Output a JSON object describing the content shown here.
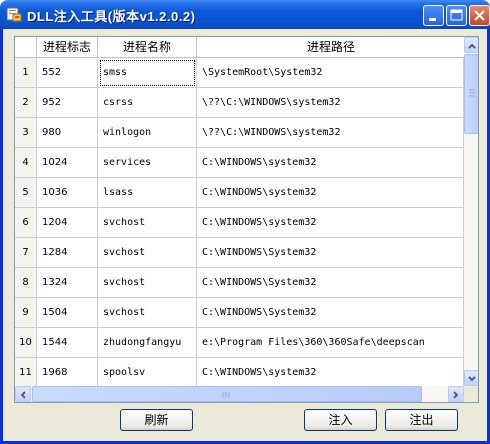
{
  "window": {
    "title": "DLL注入工具(版本v1.2.0.2)"
  },
  "grid": {
    "columns": {
      "pid": "进程标志",
      "name": "进程名称",
      "path": "进程路径"
    },
    "rows": [
      {
        "num": "1",
        "pid": "552",
        "name": "smss",
        "path": "\\SystemRoot\\System32"
      },
      {
        "num": "2",
        "pid": "952",
        "name": "csrss",
        "path": "\\??\\C:\\WINDOWS\\system32"
      },
      {
        "num": "3",
        "pid": "980",
        "name": "winlogon",
        "path": "\\??\\C:\\WINDOWS\\system32"
      },
      {
        "num": "4",
        "pid": "1024",
        "name": "services",
        "path": "C:\\WINDOWS\\system32"
      },
      {
        "num": "5",
        "pid": "1036",
        "name": "lsass",
        "path": "C:\\WINDOWS\\system32"
      },
      {
        "num": "6",
        "pid": "1204",
        "name": "svchost",
        "path": "C:\\WINDOWS\\system32"
      },
      {
        "num": "7",
        "pid": "1284",
        "name": "svchost",
        "path": "C:\\WINDOWS\\System32"
      },
      {
        "num": "8",
        "pid": "1324",
        "name": "svchost",
        "path": "C:\\WINDOWS\\System32"
      },
      {
        "num": "9",
        "pid": "1504",
        "name": "svchost",
        "path": "C:\\WINDOWS\\System32"
      },
      {
        "num": "10",
        "pid": "1544",
        "name": "zhudongfangyu",
        "path": "e:\\Program Files\\360\\360Safe\\deepscan"
      },
      {
        "num": "11",
        "pid": "1968",
        "name": "spoolsv",
        "path": "C:\\WINDOWS\\system32"
      }
    ]
  },
  "buttons": {
    "refresh": "刷新",
    "inject": "注入",
    "eject": "注出"
  },
  "icons": {
    "app": "app-icon",
    "minimize": "minimize-icon",
    "maximize": "maximize-icon",
    "close": "close-icon"
  },
  "colors": {
    "titlebar": "#0a53d3",
    "window_bg": "#ece9d8",
    "grid_border": "#7f9db9"
  }
}
